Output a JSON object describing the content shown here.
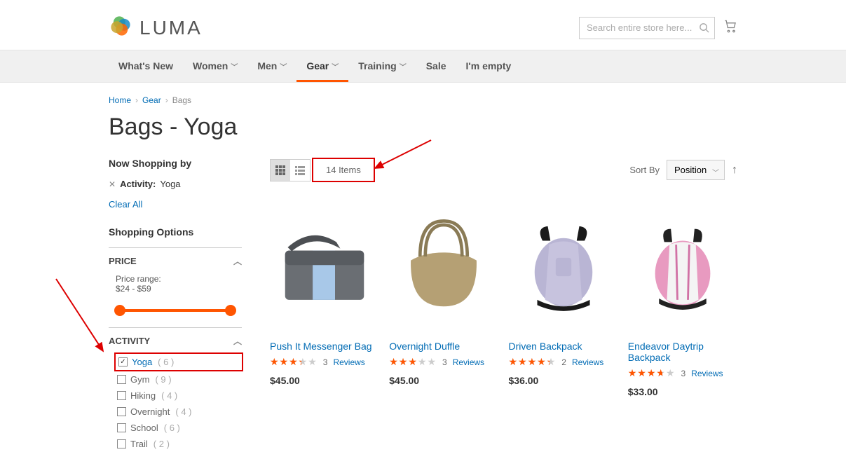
{
  "header": {
    "brand": "LUMA",
    "search_placeholder": "Search entire store here..."
  },
  "nav": {
    "items": [
      {
        "label": "What's New",
        "hasDropdown": false
      },
      {
        "label": "Women",
        "hasDropdown": true
      },
      {
        "label": "Men",
        "hasDropdown": true
      },
      {
        "label": "Gear",
        "hasDropdown": true,
        "active": true
      },
      {
        "label": "Training",
        "hasDropdown": true
      },
      {
        "label": "Sale",
        "hasDropdown": false
      },
      {
        "label": "I'm empty",
        "hasDropdown": false
      }
    ]
  },
  "breadcrumbs": {
    "items": [
      "Home",
      "Gear",
      "Bags"
    ]
  },
  "page_title": "Bags - Yoga",
  "sidebar": {
    "now_shopping_heading": "Now Shopping by",
    "applied": {
      "label": "Activity:",
      "value": "Yoga"
    },
    "clear_all": "Clear All",
    "shopping_options_heading": "Shopping Options",
    "price": {
      "heading": "PRICE",
      "range_label": "Price range:",
      "range_value": "$24 - $59"
    },
    "activity": {
      "heading": "ACTIVITY",
      "items": [
        {
          "name": "Yoga",
          "count": "6",
          "checked": true,
          "highlighted": true
        },
        {
          "name": "Gym",
          "count": "9",
          "checked": false
        },
        {
          "name": "Hiking",
          "count": "4",
          "checked": false
        },
        {
          "name": "Overnight",
          "count": "4",
          "checked": false
        },
        {
          "name": "School",
          "count": "6",
          "checked": false
        },
        {
          "name": "Trail",
          "count": "2",
          "checked": false
        }
      ]
    }
  },
  "toolbar": {
    "item_count": "14 Items",
    "sort_label": "Sort By",
    "sort_value": "Position"
  },
  "products": [
    {
      "name": "Push It Messenger Bag",
      "rating_pct": 67,
      "reviews": "3",
      "reviews_label": "Reviews",
      "price": "$45.00"
    },
    {
      "name": "Overnight Duffle",
      "rating_pct": 60,
      "reviews": "3",
      "reviews_label": "Reviews",
      "price": "$45.00"
    },
    {
      "name": "Driven Backpack",
      "rating_pct": 87,
      "reviews": "2",
      "reviews_label": "Reviews",
      "price": "$36.00"
    },
    {
      "name": "Endeavor Daytrip Backpack",
      "rating_pct": 73,
      "reviews": "3",
      "reviews_label": "Reviews",
      "price": "$33.00"
    }
  ]
}
